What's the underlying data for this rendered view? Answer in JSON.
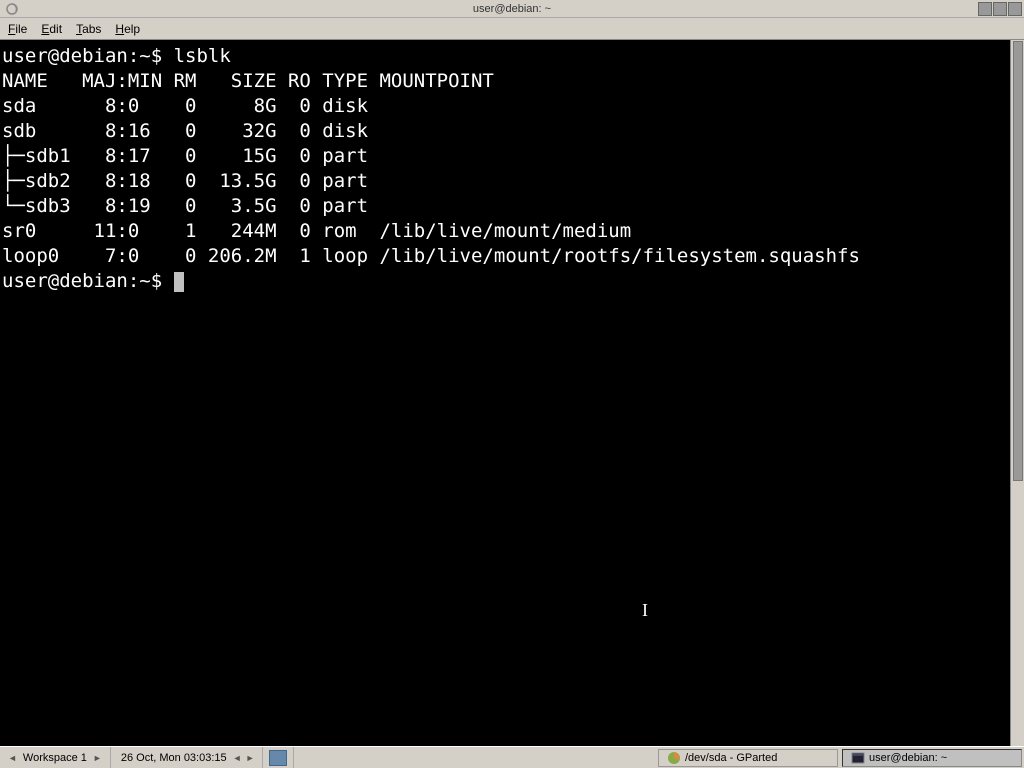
{
  "titlebar": {
    "title": "user@debian: ~"
  },
  "menubar": {
    "items": [
      "File",
      "Edit",
      "Tabs",
      "Help"
    ]
  },
  "terminal": {
    "prompt1": "user@debian:~$ ",
    "command1": "lsblk",
    "header": "NAME   MAJ:MIN RM   SIZE RO TYPE MOUNTPOINT",
    "rows": [
      "sda      8:0    0     8G  0 disk ",
      "sdb      8:16   0    32G  0 disk ",
      "├─sdb1   8:17   0    15G  0 part ",
      "├─sdb2   8:18   0  13.5G  0 part ",
      "└─sdb3   8:19   0   3.5G  0 part ",
      "sr0     11:0    1   244M  0 rom  /lib/live/mount/medium",
      "loop0    7:0    0 206.2M  1 loop /lib/live/mount/rootfs/filesystem.squashfs"
    ],
    "prompt2": "user@debian:~$ "
  },
  "panel": {
    "workspace": "Workspace 1",
    "clock": "26 Oct, Mon 03:03:15",
    "tasks": [
      {
        "label": "/dev/sda - GParted",
        "active": false
      },
      {
        "label": "user@debian: ~",
        "active": true
      }
    ]
  }
}
